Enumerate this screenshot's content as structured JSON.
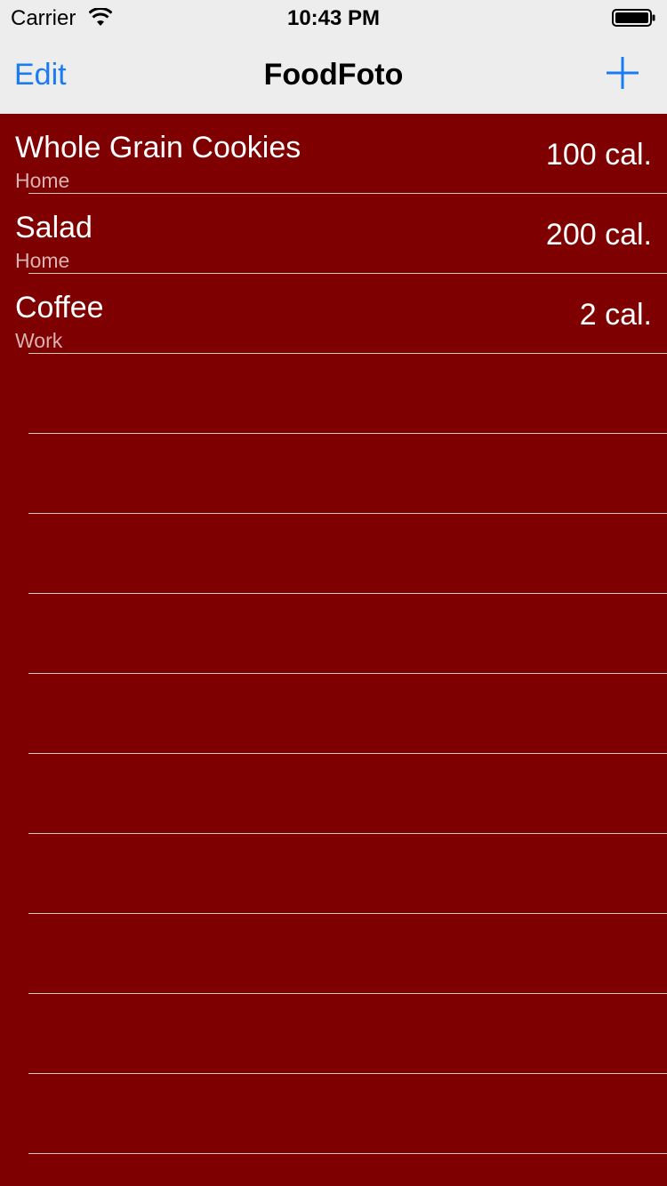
{
  "status_bar": {
    "carrier": "Carrier",
    "time": "10:43 PM",
    "icons": [
      "wifi-icon",
      "battery-icon"
    ]
  },
  "nav_bar": {
    "edit_label": "Edit",
    "title": "FoodFoto",
    "add_icon": "plus-icon",
    "accent_color": "#1a7cf2"
  },
  "table": {
    "background_color": "#7f0000",
    "rows": [
      {
        "title": "Whole Grain Cookies",
        "subtitle": "Home",
        "calories": "100 cal."
      },
      {
        "title": "Salad",
        "subtitle": "Home",
        "calories": "200 cal."
      },
      {
        "title": "Coffee",
        "subtitle": "Work",
        "calories": "2 cal."
      },
      {
        "title": "",
        "subtitle": "",
        "calories": ""
      },
      {
        "title": "",
        "subtitle": "",
        "calories": ""
      },
      {
        "title": "",
        "subtitle": "",
        "calories": ""
      },
      {
        "title": "",
        "subtitle": "",
        "calories": ""
      },
      {
        "title": "",
        "subtitle": "",
        "calories": ""
      },
      {
        "title": "",
        "subtitle": "",
        "calories": ""
      },
      {
        "title": "",
        "subtitle": "",
        "calories": ""
      },
      {
        "title": "",
        "subtitle": "",
        "calories": ""
      },
      {
        "title": "",
        "subtitle": "",
        "calories": ""
      },
      {
        "title": "",
        "subtitle": "",
        "calories": ""
      },
      {
        "title": "",
        "subtitle": "",
        "calories": ""
      }
    ]
  }
}
